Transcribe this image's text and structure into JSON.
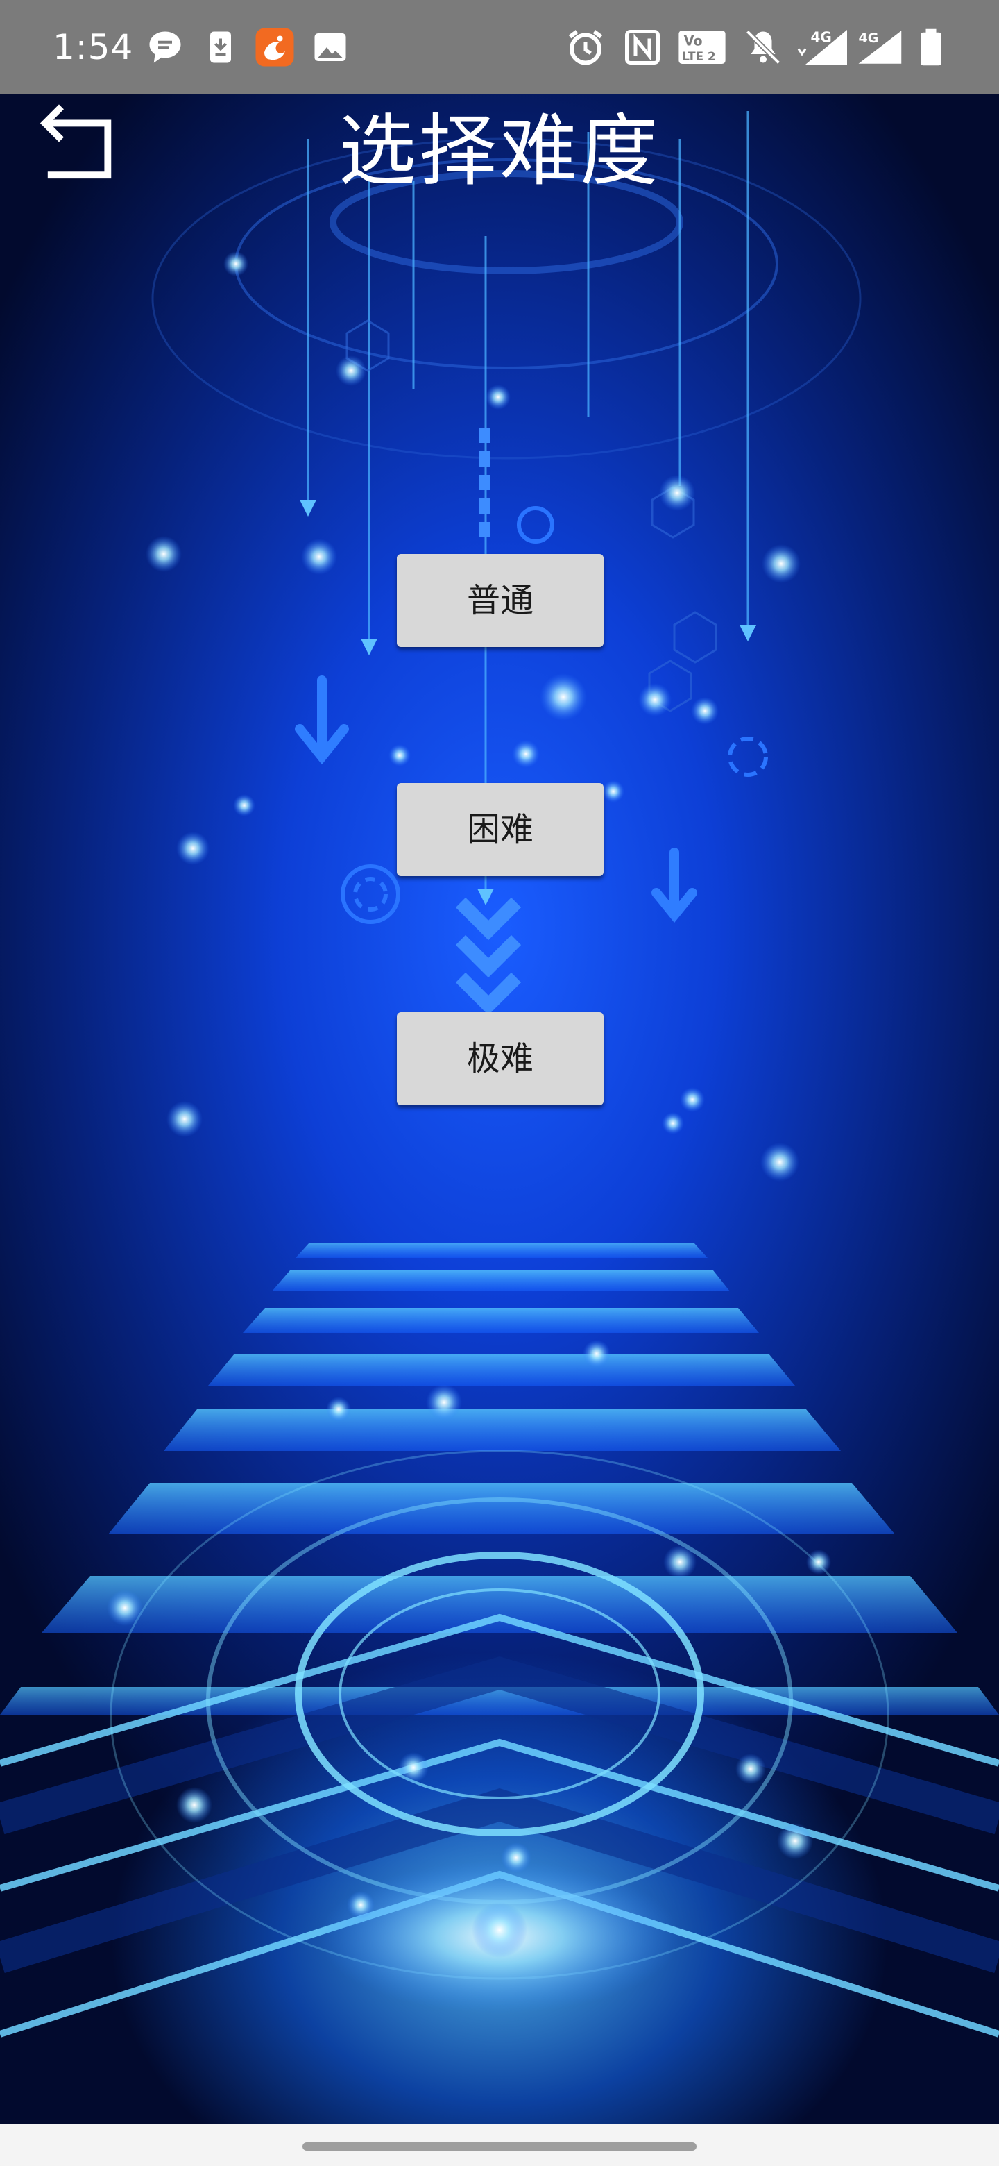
{
  "status_bar": {
    "time": "1:54",
    "left_icons": [
      "chat-bubble-icon",
      "download-icon",
      "uc-browser-icon",
      "image-icon"
    ],
    "right_icons": [
      "alarm-icon",
      "nfc-icon",
      "volte-icon",
      "mute-icon",
      "signal-4g-icon",
      "signal-4g-icon",
      "battery-icon"
    ],
    "volte_text": "Vo LTE 2",
    "network_label": "4G"
  },
  "header": {
    "title": "选择难度",
    "back_icon": "back-arrow-icon"
  },
  "difficulty": {
    "normal": "普通",
    "hard": "困难",
    "extreme": "极难"
  },
  "colors": {
    "status_bar": "#7b7b7b",
    "button_bg": "#d8d8d8",
    "accent_blue": "#1a5dff",
    "nav_bar": "#f4f4f4"
  }
}
